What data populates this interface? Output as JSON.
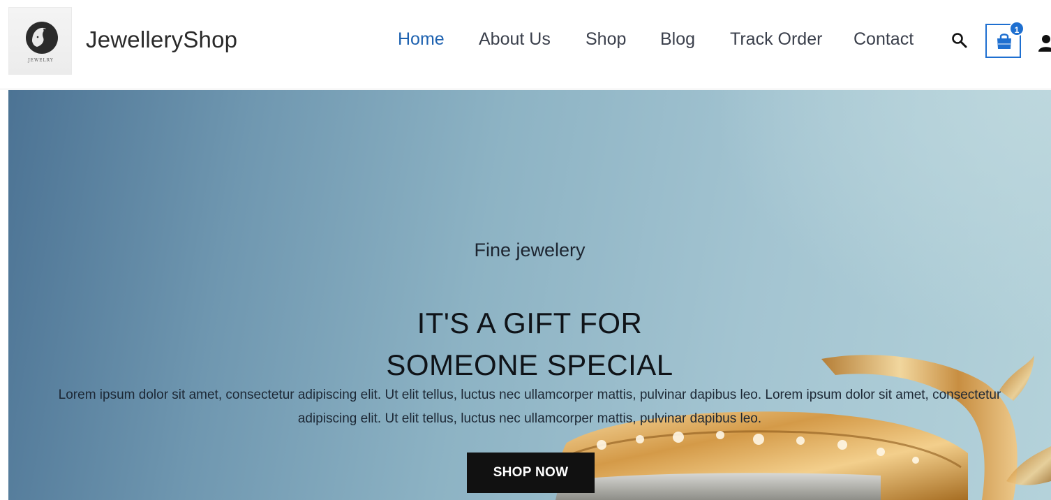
{
  "header": {
    "logo_text": "JEWELRY",
    "brand": "JewelleryShop",
    "nav": [
      {
        "label": "Home",
        "active": true
      },
      {
        "label": "About Us",
        "active": false
      },
      {
        "label": "Shop",
        "active": false
      },
      {
        "label": "Blog",
        "active": false
      },
      {
        "label": "Track Order",
        "active": false
      },
      {
        "label": "Contact",
        "active": false
      }
    ],
    "search_icon": "search-icon",
    "cart_icon": "shopping-bag-icon",
    "cart_count": "1",
    "account_icon": "user-icon"
  },
  "hero": {
    "eyebrow": "Fine jewelery",
    "title_line1": "IT'S A GIFT FOR",
    "title_line2": "SOMEONE SPECIAL",
    "body": "Lorem ipsum dolor sit amet, consectetur adipiscing elit. Ut elit tellus, luctus nec ullamcorper mattis, pulvinar dapibus leo. Lorem ipsum dolor sit amet, consectetur adipiscing elit. Ut elit tellus, luctus nec ullamcorper mattis, pulvinar dapibus leo.",
    "cta": "SHOP NOW"
  },
  "colors": {
    "accent": "#1e62b0",
    "cart_accent": "#1e6fd0",
    "nav_text": "#3a3f4b",
    "cta_bg": "#111111",
    "cta_text": "#ffffff"
  }
}
